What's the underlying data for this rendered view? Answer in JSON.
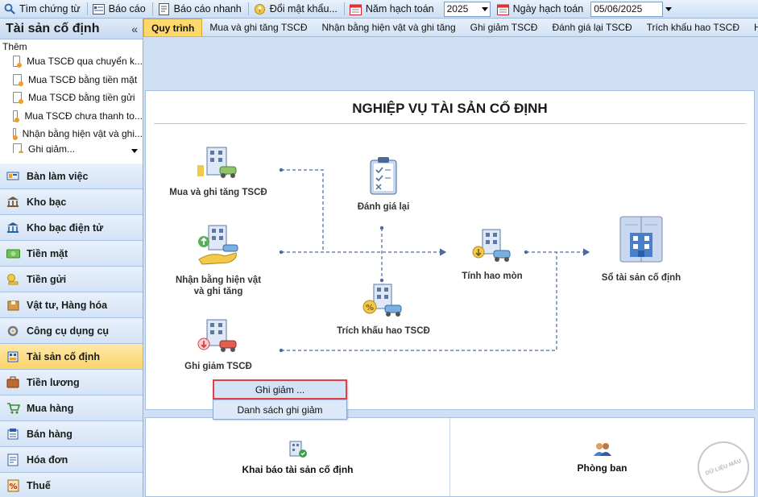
{
  "toolbar": {
    "items": [
      {
        "label": "Tìm chứng từ",
        "icon": "search-icon"
      },
      {
        "label": "Báo cáo",
        "icon": "report-icon"
      },
      {
        "label": "Báo cáo nhanh",
        "icon": "quick-report-icon"
      },
      {
        "label": "Đổi mật khẩu...",
        "icon": "key-icon"
      }
    ],
    "year_label": "Năm hạch toán",
    "year_value": "2025",
    "date_label": "Ngày hạch toán",
    "date_value": "05/06/2025"
  },
  "sidebar": {
    "title": "Tài sản cố định",
    "collapse": "«",
    "quick_header": "Thêm",
    "quick_items": [
      "Mua TSCĐ qua chuyển k...",
      "Mua TSCĐ bằng tiền mặt",
      "Mua TSCĐ bằng tiền gửi",
      "Mua TSCĐ chưa thanh to...",
      "Nhận bằng hiện vật và ghi...",
      "Ghi giảm..."
    ],
    "nav": [
      {
        "label": "Bàn làm việc",
        "icon": "desk-icon"
      },
      {
        "label": "Kho bạc",
        "icon": "treasury-icon"
      },
      {
        "label": "Kho bạc điện tử",
        "icon": "e-treasury-icon"
      },
      {
        "label": "Tiền mặt",
        "icon": "cash-icon"
      },
      {
        "label": "Tiền gửi",
        "icon": "deposit-icon"
      },
      {
        "label": "Vật tư, Hàng hóa",
        "icon": "goods-icon"
      },
      {
        "label": "Công cụ dụng cụ",
        "icon": "tools-icon"
      },
      {
        "label": "Tài sản cố định",
        "icon": "fixed-asset-icon",
        "active": true
      },
      {
        "label": "Tiền lương",
        "icon": "salary-icon"
      },
      {
        "label": "Mua hàng",
        "icon": "cart-icon"
      },
      {
        "label": "Bán hàng",
        "icon": "sales-icon"
      },
      {
        "label": "Hóa đơn",
        "icon": "invoice-icon"
      },
      {
        "label": "Thuế",
        "icon": "tax-icon"
      }
    ]
  },
  "tabs": [
    {
      "label": "Quy trình",
      "active": true
    },
    {
      "label": "Mua và ghi tăng TSCĐ"
    },
    {
      "label": "Nhận bằng hiện vật và ghi tăng"
    },
    {
      "label": "Ghi giảm TSCĐ"
    },
    {
      "label": "Đánh giá lại TSCĐ"
    },
    {
      "label": "Trích khấu hao TSCĐ"
    },
    {
      "label": "Hao mòn T..."
    }
  ],
  "flow": {
    "title": "NGHIỆP VỤ TÀI SẢN CỐ ĐỊNH",
    "nodes": {
      "mua": "Mua và ghi tăng TSCĐ",
      "nhan_line1": "Nhận bằng hiện vật",
      "nhan_line2": "và ghi tăng",
      "ghigiam": "Ghi giảm TSCĐ",
      "danhgia": "Đánh giá lại",
      "trich": "Trích khấu hao TSCĐ",
      "haomon": "Tính hao mòn",
      "so": "Sổ tài sản cố định"
    }
  },
  "context_menu": {
    "items": [
      "Ghi giảm ...",
      "Danh sách ghi giảm"
    ]
  },
  "bottom": {
    "khaibao": "Khai báo tài sản cố định",
    "phongban": "Phòng ban"
  },
  "watermark": "DỮ LIỆU MẪU",
  "colors": {
    "accent": "#ffd86b",
    "highlight_border": "#e04040",
    "flow_line": "#4a6a9a"
  }
}
